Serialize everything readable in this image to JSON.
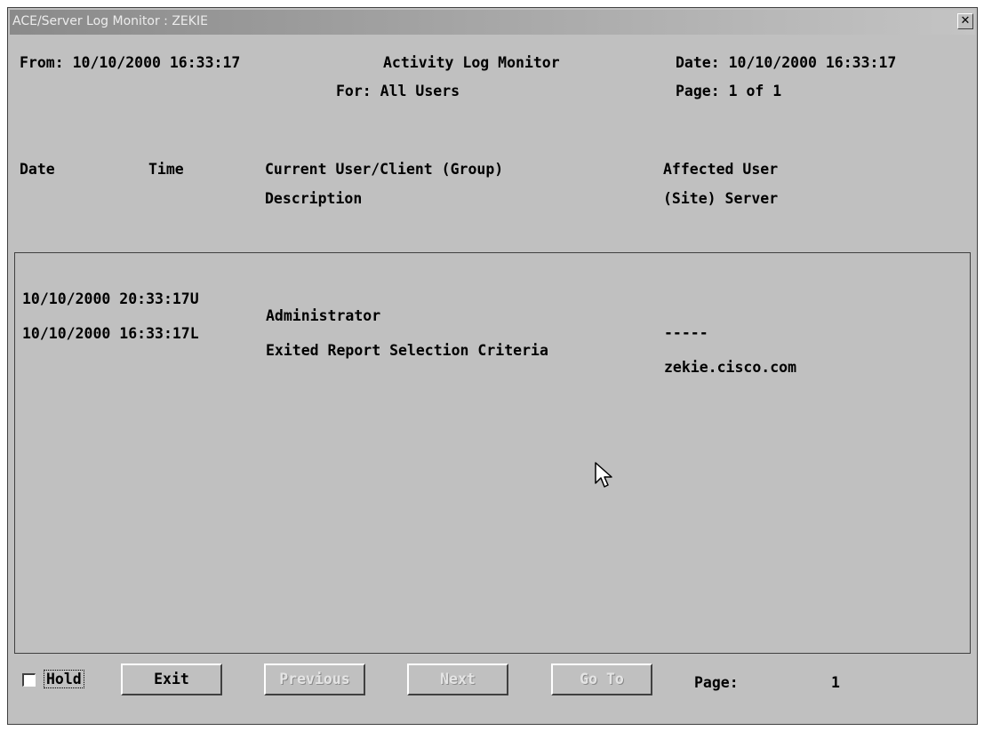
{
  "window": {
    "title": "ACE/Server Log Monitor : ZEKIE"
  },
  "header": {
    "from": "From: 10/10/2000 16:33:17",
    "title": "Activity Log Monitor",
    "date": "Date: 10/10/2000 16:33:17",
    "for": "For: All Users",
    "page": "Page: 1 of 1"
  },
  "columns": {
    "date": "Date",
    "time": "Time",
    "current_user": "Current User/Client (Group)",
    "description": "Description",
    "affected_user": "Affected User",
    "site_server": "(Site) Server"
  },
  "log_rows": [
    {
      "datetime": "10/10/2000 20:33:17U",
      "description": "Administrator",
      "affected": "-----"
    },
    {
      "datetime": "10/10/2000 16:33:17L",
      "description": "Exited Report Selection Criteria",
      "affected": "zekie.cisco.com"
    }
  ],
  "footer": {
    "hold_label": "Hold",
    "hold_checked": false,
    "exit_label": "Exit",
    "previous_label": "Previous",
    "next_label": "Next",
    "goto_label": "Go To",
    "page_label": "Page:",
    "page_value": "1"
  },
  "icons": {
    "close": "close-icon",
    "cursor": "mouse-cursor-icon"
  }
}
